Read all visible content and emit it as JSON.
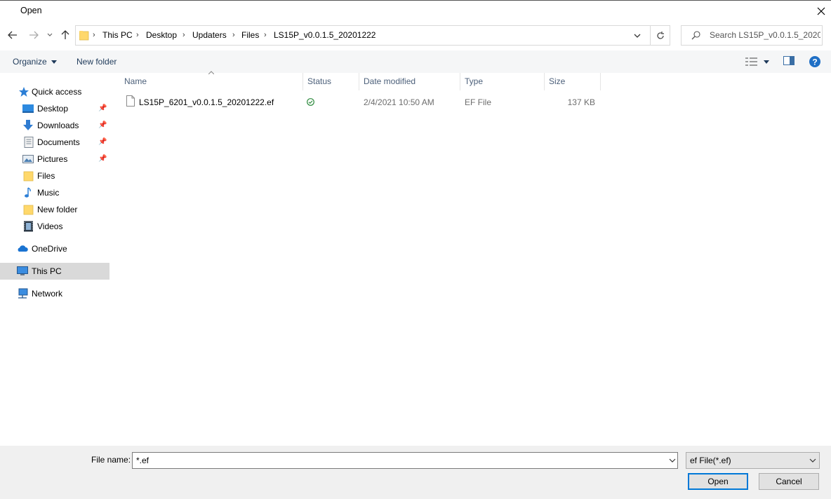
{
  "window": {
    "title": "Open"
  },
  "address": {
    "crumbs": [
      "This PC",
      "Desktop",
      "Updaters",
      "Files",
      "LS15P_v0.0.1.5_20201222"
    ]
  },
  "search": {
    "placeholder": "Search LS15P_v0.0.1.5_20201..."
  },
  "toolbar": {
    "organize": "Organize",
    "new_folder": "New folder"
  },
  "sidebar": {
    "items": [
      {
        "label": "Quick access",
        "icon": "star-icon"
      },
      {
        "label": "Desktop",
        "icon": "desktop-icon",
        "pinned": true
      },
      {
        "label": "Downloads",
        "icon": "download-icon",
        "pinned": true
      },
      {
        "label": "Documents",
        "icon": "document-icon",
        "pinned": true
      },
      {
        "label": "Pictures",
        "icon": "picture-icon",
        "pinned": true
      },
      {
        "label": "Files",
        "icon": "folder-icon"
      },
      {
        "label": "Music",
        "icon": "music-icon"
      },
      {
        "label": "New folder",
        "icon": "folder-icon"
      },
      {
        "label": "Videos",
        "icon": "video-icon"
      },
      {
        "label": "OneDrive",
        "icon": "cloud-icon"
      },
      {
        "label": "This PC",
        "icon": "computer-icon",
        "selected": true
      },
      {
        "label": "Network",
        "icon": "network-icon"
      }
    ]
  },
  "columns": [
    "Name",
    "Status",
    "Date modified",
    "Type",
    "Size"
  ],
  "files": [
    {
      "name": "LS15P_6201_v0.0.1.5_20201222.ef",
      "status": "synced",
      "date": "2/4/2021 10:50 AM",
      "type": "EF File",
      "size": "137 KB"
    }
  ],
  "footer": {
    "file_name_label": "File name:",
    "file_name_value": "*.ef",
    "filter": "ef File(*.ef)",
    "open": "Open",
    "cancel": "Cancel"
  },
  "colors": {
    "accent": "#0078d7",
    "selected_bg": "#d9d9d9",
    "folder": "#ffd86b"
  }
}
